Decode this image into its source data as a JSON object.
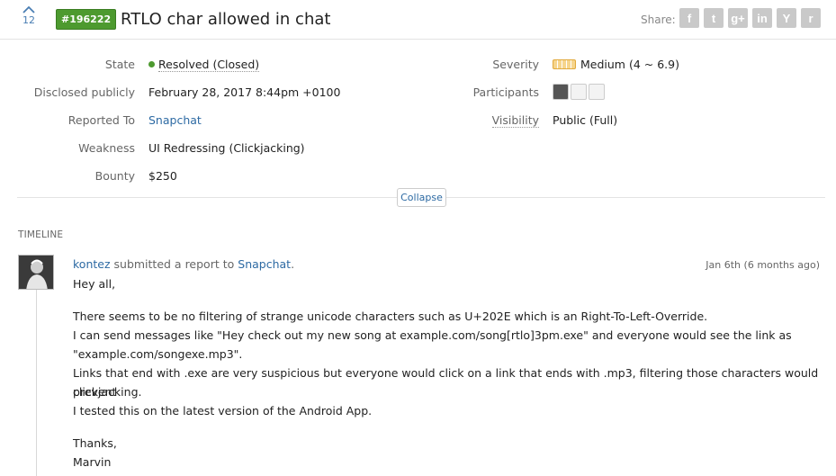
{
  "header": {
    "vote_count": "12",
    "report_id": "#196222",
    "title": "RTLO char allowed in chat",
    "share_label": "Share:",
    "share_icons": [
      {
        "name": "facebook-icon",
        "glyph": "f"
      },
      {
        "name": "twitter-icon",
        "glyph": "t"
      },
      {
        "name": "google-plus-icon",
        "glyph": "g+"
      },
      {
        "name": "linkedin-icon",
        "glyph": "in"
      },
      {
        "name": "hacker-news-icon",
        "glyph": "Y"
      },
      {
        "name": "reddit-icon",
        "glyph": "r"
      }
    ]
  },
  "meta": {
    "state_label": "State",
    "state_value": "Resolved (Closed)",
    "disclosed_label": "Disclosed publicly",
    "disclosed_value": "February 28, 2017 8:44pm +0100",
    "reported_to_label": "Reported To",
    "reported_to_value": "Snapchat",
    "weakness_label": "Weakness",
    "weakness_value": "UI Redressing (Clickjacking)",
    "bounty_label": "Bounty",
    "bounty_value": "$250",
    "severity_label": "Severity",
    "severity_value": "Medium (4 ~ 6.9)",
    "participants_label": "Participants",
    "visibility_label": "Visibility",
    "visibility_value": "Public (Full)"
  },
  "collapse_label": "Collapse",
  "timeline": {
    "label": "TIMELINE",
    "event": {
      "user": "kontez",
      "action": "submitted a report to",
      "target": "Snapchat",
      "period": ".",
      "time": "Jan 6th (6 months ago)",
      "lines": [
        "Hey all,",
        "",
        "There seems to be no filtering of strange unicode characters such as U+202E which is an Right-To-Left-Override.",
        "I can send messages like \"Hey check out my new song at example.com/song[rtlo]3pm.exe\" and everyone would see the link as",
        "\"example.com/songexe.mp3\".",
        "Links that end with .exe are very suspicious but everyone would click on a link that ends with .mp3, filtering those characters would prevent",
        "clickjacking.",
        "I tested this on the latest version of the Android App.",
        "",
        "Thanks,",
        "Marvin"
      ]
    }
  },
  "colors": {
    "accent": "#2d6aa3",
    "resolved": "#4d9a2f",
    "severity": "#e1a93b"
  }
}
